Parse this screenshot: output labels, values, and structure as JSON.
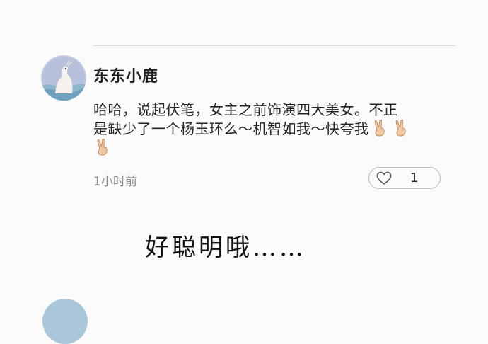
{
  "comment": {
    "username": "东东小鹿",
    "text_line1": "哈哈，说起伏笔，女主之前饰演四大美女。不正",
    "text_line2": "是缺少了一个杨玉环么～机智如我～快夸我",
    "emoji_icon": "victory-hand-icon",
    "time": "1小时前",
    "likes": "1"
  },
  "caption": "好聪明哦……",
  "colors": {
    "avatar_bg": "#b9c2da",
    "divider": "#dadada",
    "muted_text": "#8a8a8a",
    "next_avatar": "#a9c7d8"
  }
}
